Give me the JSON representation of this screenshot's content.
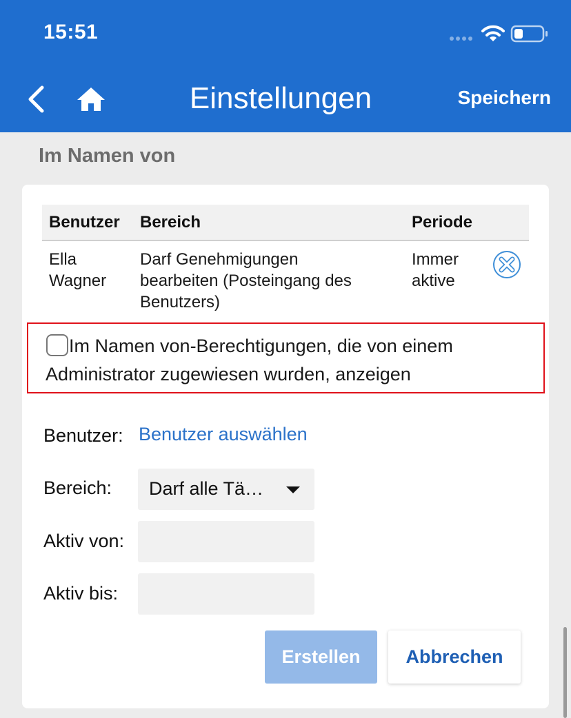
{
  "status_bar": {
    "time": "15:51"
  },
  "nav": {
    "title": "Einstellungen",
    "save_label": "Speichern"
  },
  "section": {
    "title": "Im Namen von"
  },
  "table": {
    "headers": {
      "user": "Benutzer",
      "area": "Bereich",
      "period": "Periode"
    },
    "rows": [
      {
        "user_line1": "Ella",
        "user_line2": "Wagner",
        "area_line1": "Darf Genehmigungen",
        "area_line2": "bearbeiten (Posteingang des",
        "area_line3": "Benutzers)",
        "period_line1": "Immer",
        "period_line2": "aktive"
      }
    ]
  },
  "admin_option": {
    "checked": false,
    "label": "Im Namen von-Berechtigungen, die von einem Administrator zugewiesen wurden, anzeigen"
  },
  "form": {
    "user_label": "Benutzer:",
    "user_link": "Benutzer auswählen",
    "area_label": "Bereich:",
    "area_value": "Darf alle Tä…",
    "active_from_label": "Aktiv von:",
    "active_from_value": "",
    "active_to_label": "Aktiv bis:",
    "active_to_value": ""
  },
  "buttons": {
    "create": "Erstellen",
    "cancel": "Abbrechen"
  },
  "colors": {
    "header": "#1f6ecf",
    "link": "#2b72c9",
    "highlight_border": "#e0111a",
    "create_disabled": "#94b9e8",
    "cancel_text": "#1e5fb4"
  },
  "icons": [
    "wifi-icon",
    "battery-icon",
    "back-icon",
    "home-icon",
    "remove-circle-icon",
    "dropdown-arrow-icon"
  ]
}
